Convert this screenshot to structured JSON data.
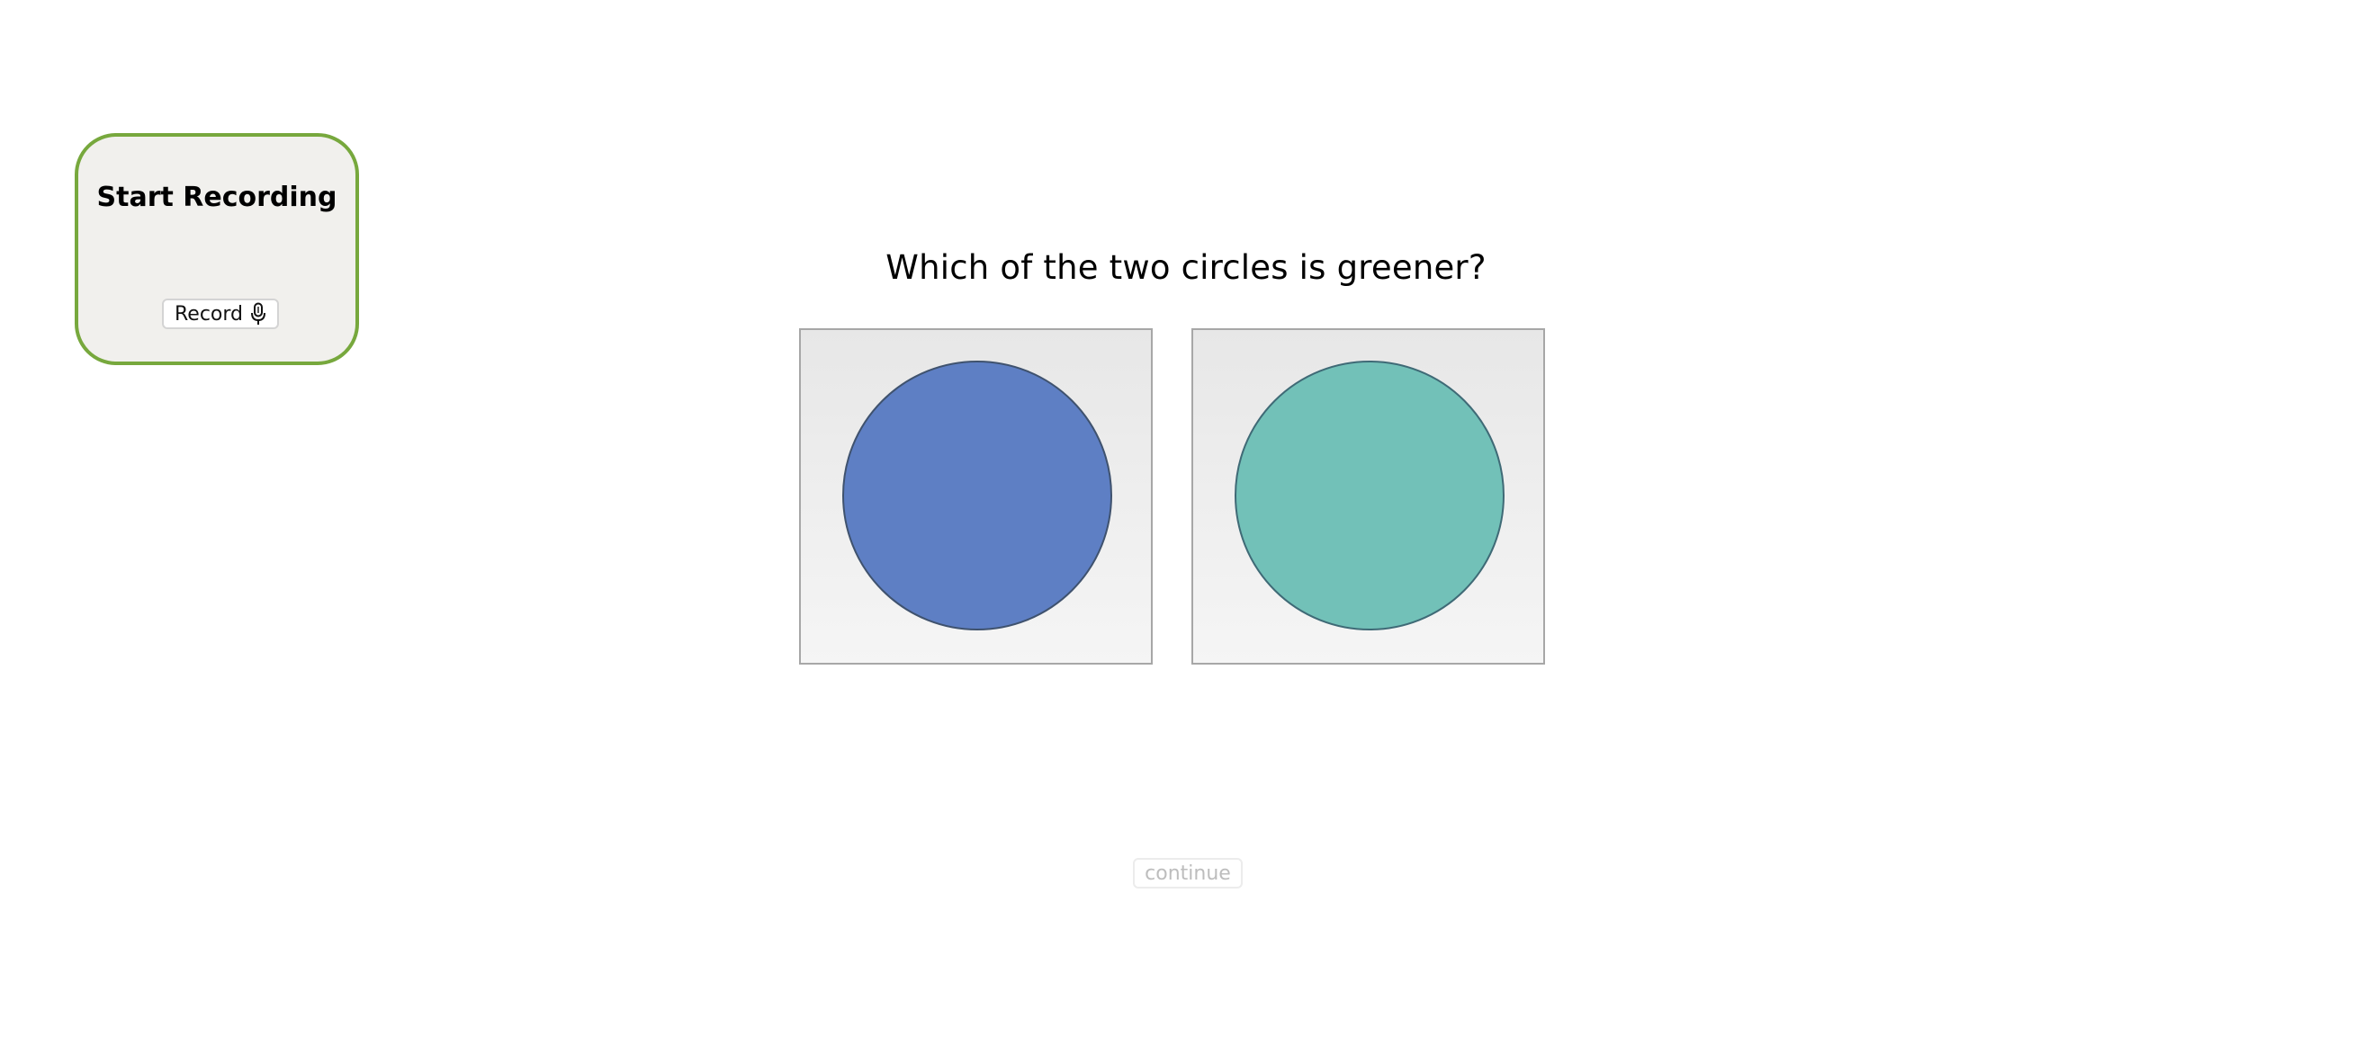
{
  "recording_panel": {
    "title": "Start Recording",
    "record_button_label": "Record",
    "record_icon": "microphone-icon",
    "border_color": "#77a83d"
  },
  "question": {
    "text": "Which of the two circles is greener?"
  },
  "choices": [
    {
      "shape": "circle",
      "fill_color": "#5e7fc4"
    },
    {
      "shape": "circle",
      "fill_color": "#72c1b8"
    }
  ],
  "continue_button": {
    "label": "continue",
    "state": "disabled"
  }
}
